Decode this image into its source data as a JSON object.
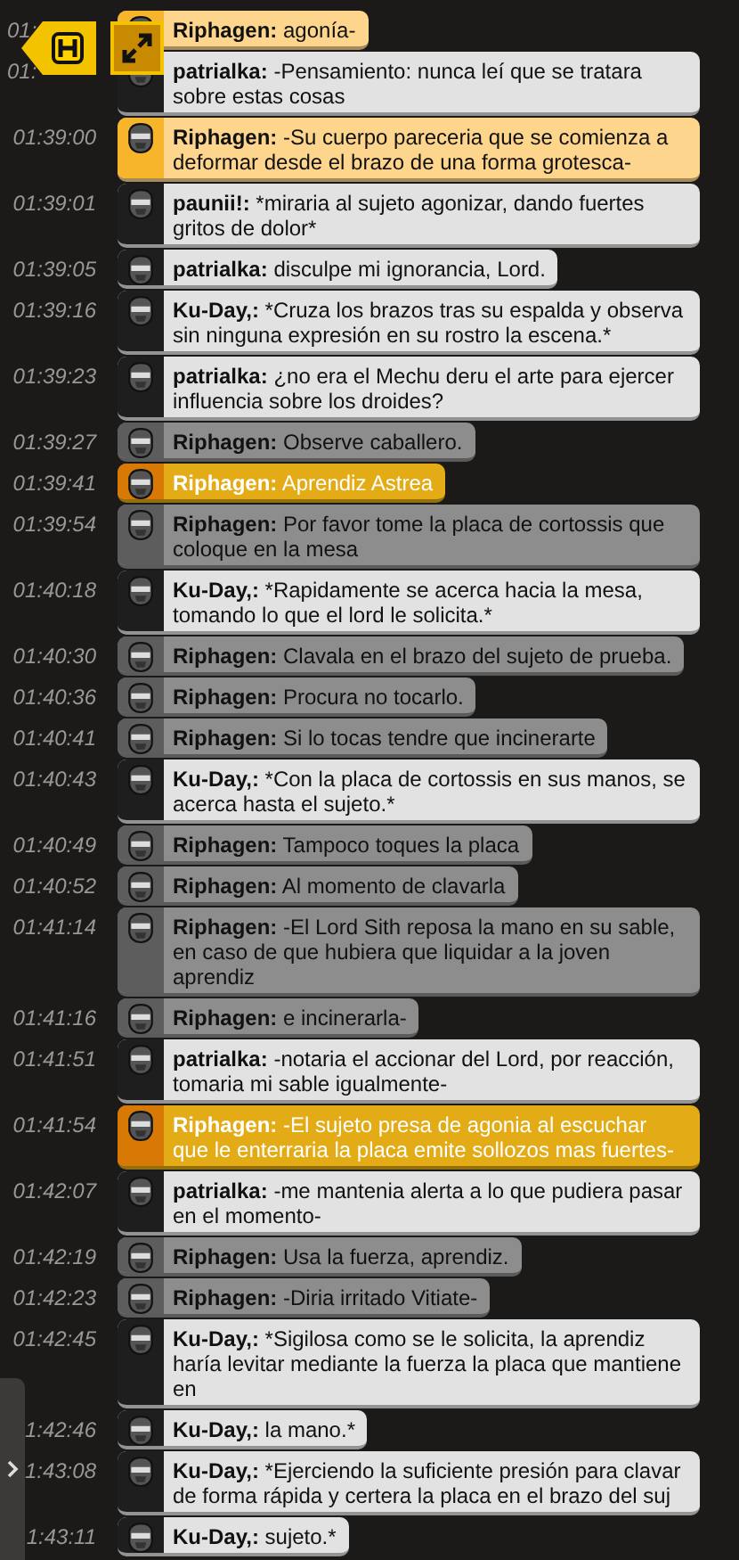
{
  "messages": [
    {
      "time": "01:",
      "user": "Riphagen:",
      "text": "agonía-",
      "kind": "orange"
    },
    {
      "time": "01:",
      "user": "patrialka:",
      "text": "-Pensamiento: nunca leí que se tratara sobre estas cosas",
      "kind": "white"
    },
    {
      "time": "01:39:00",
      "user": "Riphagen:",
      "text": "-Su cuerpo pareceria que se comienza a deformar desde el brazo de una forma grotesca-",
      "kind": "orange"
    },
    {
      "time": "01:39:01",
      "user": "paunii!:",
      "text": "*miraria al sujeto agonizar, dando fuertes gritos de dolor*",
      "kind": "white"
    },
    {
      "time": "01:39:05",
      "user": "patrialka:",
      "text": "disculpe mi ignorancia, Lord.",
      "kind": "white"
    },
    {
      "time": "01:39:16",
      "user": "Ku-Day,:",
      "text": "*Cruza los brazos tras su espalda y observa sin ninguna expresión en su rostro la escena.*",
      "kind": "white"
    },
    {
      "time": "01:39:23",
      "user": "patrialka:",
      "text": "¿no era el Mechu deru el arte para ejercer influencia sobre los droides?",
      "kind": "white"
    },
    {
      "time": "01:39:27",
      "user": "Riphagen:",
      "text": "Observe caballero.",
      "kind": "grey"
    },
    {
      "time": "01:39:41",
      "user": "Riphagen:",
      "text": "Aprendiz Astrea",
      "kind": "gold"
    },
    {
      "time": "01:39:54",
      "user": "Riphagen:",
      "text": "Por favor tome la placa de cortossis que coloque en la mesa",
      "kind": "grey"
    },
    {
      "time": "01:40:18",
      "user": "Ku-Day,:",
      "text": "*Rapidamente se acerca hacia la mesa, tomando lo que el lord le solicita.*",
      "kind": "white"
    },
    {
      "time": "01:40:30",
      "user": "Riphagen:",
      "text": "Clavala en el brazo del sujeto de prueba.",
      "kind": "grey"
    },
    {
      "time": "01:40:36",
      "user": "Riphagen:",
      "text": "Procura no tocarlo.",
      "kind": "grey"
    },
    {
      "time": "01:40:41",
      "user": "Riphagen:",
      "text": "Si lo tocas tendre que incinerarte",
      "kind": "grey"
    },
    {
      "time": "01:40:43",
      "user": "Ku-Day,:",
      "text": "*Con la placa de cortossis en sus manos, se acerca hasta el sujeto.*",
      "kind": "white"
    },
    {
      "time": "01:40:49",
      "user": "Riphagen:",
      "text": "Tampoco toques la placa",
      "kind": "grey"
    },
    {
      "time": "01:40:52",
      "user": "Riphagen:",
      "text": "Al momento de clavarla",
      "kind": "grey"
    },
    {
      "time": "01:41:14",
      "user": "Riphagen:",
      "text": "-El Lord Sith reposa la mano en su sable, en caso de que hubiera que liquidar a la joven aprendiz",
      "kind": "grey"
    },
    {
      "time": "01:41:16",
      "user": "Riphagen:",
      "text": "e incinerarla-",
      "kind": "grey"
    },
    {
      "time": "01:41:51",
      "user": "patrialka:",
      "text": "-notaria el accionar del Lord, por reacción, tomaria mi sable igualmente-",
      "kind": "white"
    },
    {
      "time": "01:41:54",
      "user": "Riphagen:",
      "text": "-El sujeto presa de agonia al escuchar que le enterraria la placa emite sollozos mas fuertes-",
      "kind": "gold"
    },
    {
      "time": "01:42:07",
      "user": "patrialka:",
      "text": "-me mantenia alerta a lo que pudiera pasar en el momento-",
      "kind": "white"
    },
    {
      "time": "01:42:19",
      "user": "Riphagen:",
      "text": "Usa la fuerza, aprendiz.",
      "kind": "grey"
    },
    {
      "time": "01:42:23",
      "user": "Riphagen:",
      "text": "-Diria irritado Vitiate-",
      "kind": "grey"
    },
    {
      "time": "01:42:45",
      "user": "Ku-Day,:",
      "text": "*Sigilosa como se le solicita, la aprendiz haría levitar mediante la fuerza la placa que mantiene en",
      "kind": "white"
    },
    {
      "time": "1:42:46",
      "user": "Ku-Day,:",
      "text": "la mano.*",
      "kind": "white"
    },
    {
      "time": "1:43:08",
      "user": "Ku-Day,:",
      "text": "*Ejerciendo la suficiente presión para clavar de forma rápida y certera la placa en el brazo del suj",
      "kind": "white"
    },
    {
      "time": "1:43:11",
      "user": "Ku-Day,:",
      "text": "sujeto.*",
      "kind": "white"
    }
  ]
}
